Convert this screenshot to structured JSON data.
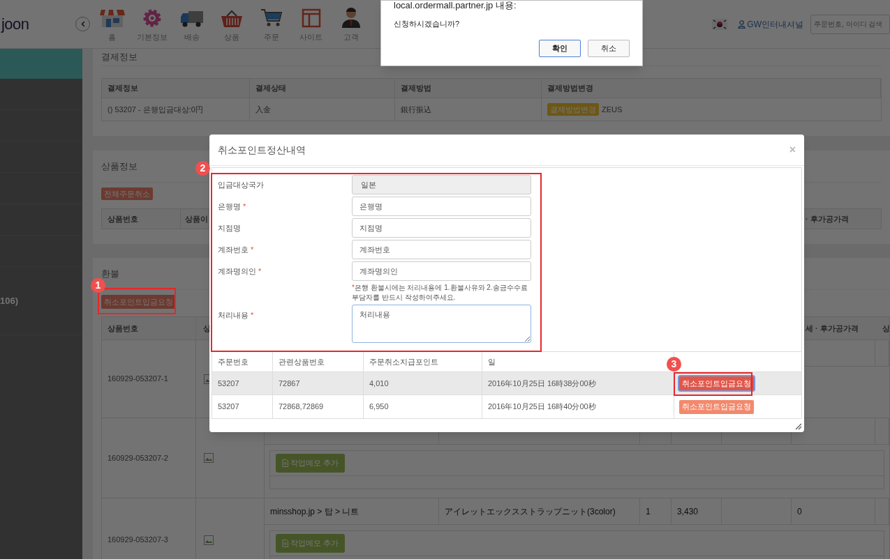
{
  "top_bar": {
    "logo": "joon",
    "nav": [
      {
        "label": "홈"
      },
      {
        "label": "기본정보"
      },
      {
        "label": "배송"
      },
      {
        "label": "상품"
      },
      {
        "label": "주문"
      },
      {
        "label": "사이트"
      },
      {
        "label": "고객"
      }
    ],
    "user": "GW인터내셔널",
    "search": {
      "placeholder": "주문번호, 아이디 검색"
    }
  },
  "sidebar": {
    "text": "106)"
  },
  "payment": {
    "title": "결제정보",
    "columns": [
      "결제정보",
      "결제상태",
      "결제방법",
      "결제방법변경"
    ],
    "row": {
      "info": "() 53207 - 은행입금대상:0円",
      "status": "入金",
      "method": "銀行振込",
      "change_button": "결제방법변경",
      "provider": "ZEUS"
    }
  },
  "products": {
    "title": "상품정보",
    "cancel_all_button": "전체주문취소",
    "columns": [
      "상품번호",
      "상품이"
    ],
    "columns_right": [
      "· 후가공가격"
    ]
  },
  "refund": {
    "title": "환불",
    "request_button": "취소포인트입금요청",
    "columns": [
      "상품번호",
      "상"
    ],
    "columns_right": [
      "세 · 후가공가격",
      "상"
    ],
    "rows": [
      {
        "product_no": "160929-053207-1"
      },
      {
        "product_no": "160929-053207-2",
        "memo_button": "작업메모 추가"
      },
      {
        "product_no": "160929-053207-3",
        "cells": [
          "minsshop.jp > 탑 > 니트",
          "アイレットエックスストラップニット(3color)",
          "1",
          "3,430",
          "0"
        ],
        "memo_button": "작업메모 추가"
      }
    ]
  },
  "alert": {
    "title": "local.ordermall.partner.jp 내용:",
    "message": "신청하시겠습니까?",
    "buttons": [
      {
        "label": "확인",
        "focused": true
      },
      {
        "label": "취소",
        "focused": false
      }
    ]
  },
  "modal": {
    "title": "취소포인트정산내역",
    "close": "×",
    "fields": [
      {
        "label": "입금대상국가",
        "kind": "readonly",
        "value": "일본"
      },
      {
        "label": "은행명",
        "marker": "*",
        "kind": "input",
        "value": "은행명"
      },
      {
        "label": "지점명",
        "kind": "input",
        "value": "지점명"
      },
      {
        "label": "계좌번호",
        "marker": "*",
        "kind": "input",
        "value": "계좌번호"
      },
      {
        "label": "계좌명의인",
        "marker": "*",
        "kind": "input",
        "value": "계좌명의인"
      },
      {
        "label": "처리내용",
        "marker": "*",
        "kind": "textarea",
        "value": "처리내용"
      }
    ],
    "note": {
      "marker": "*",
      "text": "은행 환불시에는 처리내용에 1.환불사유와 2.송금수수료 부담자를 반드시 작성하여주세요."
    },
    "table": {
      "columns": [
        "주문번호",
        "관련상품번호",
        "주문취소지급포인트",
        "일"
      ],
      "rows": [
        {
          "order_no": "53207",
          "product_nos": "72867",
          "points": "4,010",
          "date": "2016年10月25日 16時38分00秒",
          "button": "취소포인트입금요청",
          "highlighted": true,
          "focused": true
        },
        {
          "order_no": "53207",
          "product_nos": "72868,72869",
          "points": "6,950",
          "date": "2016年10月25日 16時40分00秒",
          "button": "취소포인트입금요청",
          "highlighted": false,
          "focused": false
        }
      ]
    }
  },
  "annotations": [
    {
      "number": "1"
    },
    {
      "number": "2"
    },
    {
      "number": "3"
    }
  ]
}
